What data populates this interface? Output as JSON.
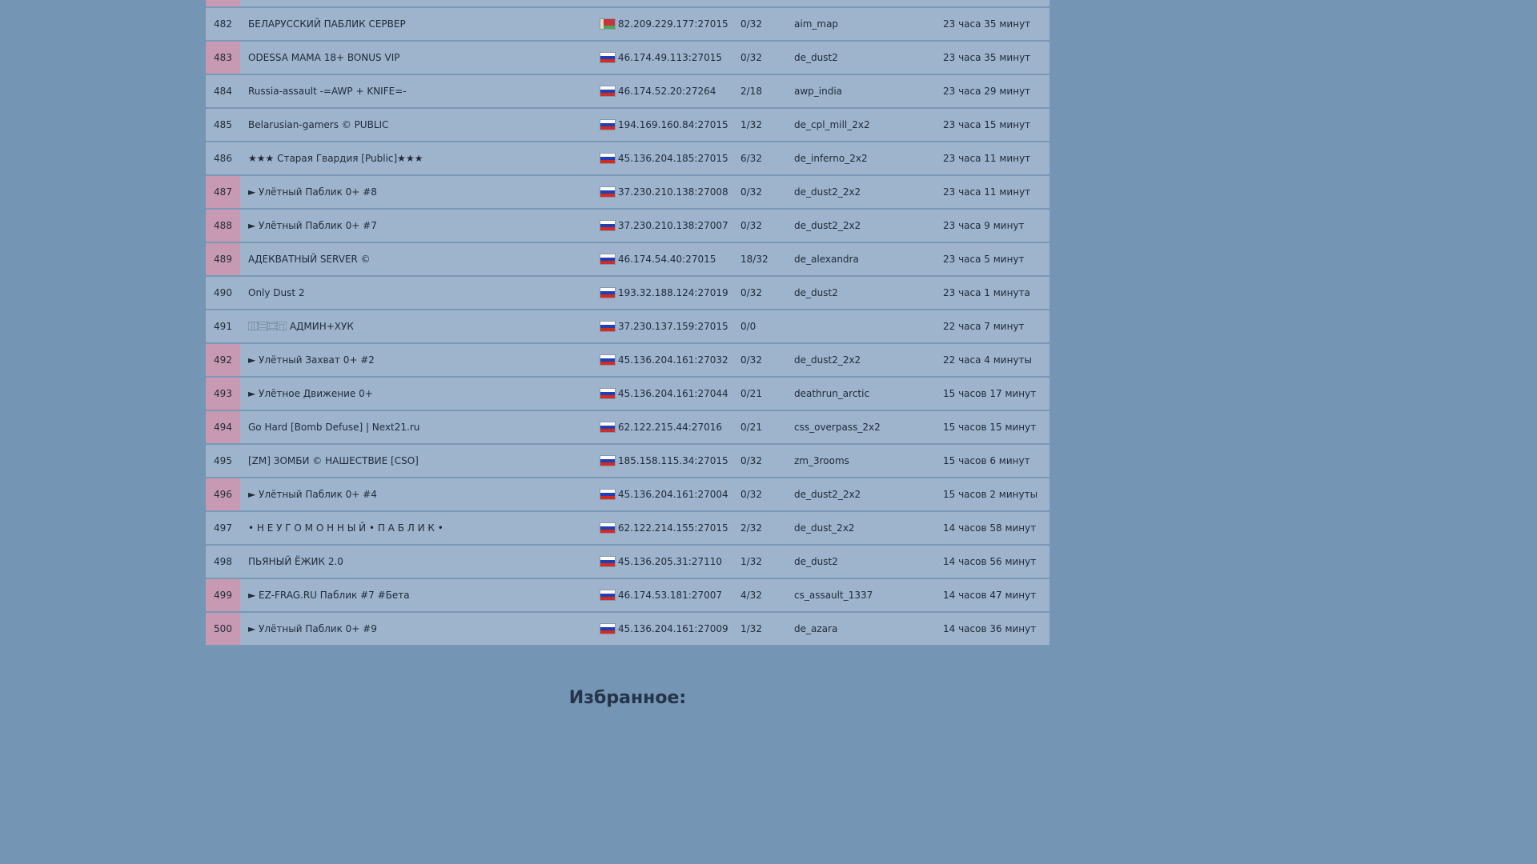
{
  "rows": [
    {
      "num": "482",
      "vip": false,
      "name": "БЕЛАРУССКИЙ ПАБЛИК СЕРВЕР",
      "flag": "by",
      "ip": "82.209.229.177:27015",
      "players": "0/32",
      "map": "aim_map",
      "time": "23 часа 35 минут"
    },
    {
      "num": "483",
      "vip": true,
      "name": "ODESSA MAMA 18+ BONUS VIP",
      "flag": "ru",
      "ip": "46.174.49.113:27015",
      "players": "0/32",
      "map": "de_dust2",
      "time": "23 часа 35 минут"
    },
    {
      "num": "484",
      "vip": false,
      "name": "Russia-assault -=AWP + KNIFE=-",
      "flag": "ru",
      "ip": "46.174.52.20:27264",
      "players": "2/18",
      "map": "awp_india",
      "time": "23 часа 29 минут"
    },
    {
      "num": "485",
      "vip": false,
      "name": "Belarusian-gamers © PUBLIC",
      "flag": "ru",
      "ip": "194.169.160.84:27015",
      "players": "1/32",
      "map": "de_cpl_mill_2x2",
      "time": "23 часа 15 минут"
    },
    {
      "num": "486",
      "vip": false,
      "name": "★★★ Старая Гвардия [Public]★★★",
      "flag": "ru",
      "ip": "45.136.204.185:27015",
      "players": "6/32",
      "map": "de_inferno_2x2",
      "time": "23 часа 11 минут"
    },
    {
      "num": "487",
      "vip": true,
      "name": "► Улётный Паблик 0+ #8",
      "flag": "ru",
      "ip": "37.230.210.138:27008",
      "players": "0/32",
      "map": "de_dust2_2x2",
      "time": "23 часа 11 минут"
    },
    {
      "num": "488",
      "vip": true,
      "name": "► Улётный Паблик 0+ #7",
      "flag": "ru",
      "ip": "37.230.210.138:27007",
      "players": "0/32",
      "map": "de_dust2_2x2",
      "time": "23 часа 9 минут"
    },
    {
      "num": "489",
      "vip": true,
      "name": "АДЕКВАТНЫЙ SERVER ©",
      "flag": "ru",
      "ip": "46.174.54.40:27015",
      "players": "18/32",
      "map": "de_alexandra",
      "time": "23 часа 5 минут"
    },
    {
      "num": "490",
      "vip": false,
      "name": "Only Dust 2",
      "flag": "ru",
      "ip": "193.32.188.124:27019",
      "players": "0/32",
      "map": "de_dust2",
      "time": "23 часа 1 минута"
    },
    {
      "num": "491",
      "vip": false,
      "name": "⿲⿳⿴⿵ АДМИН+ХУК",
      "flag": "ru",
      "ip": "37.230.137.159:27015",
      "players": "0/0",
      "map": "",
      "time": "22 часа 7 минут"
    },
    {
      "num": "492",
      "vip": true,
      "name": "► Улётный Захват 0+ #2",
      "flag": "ru",
      "ip": "45.136.204.161:27032",
      "players": "0/32",
      "map": "de_dust2_2x2",
      "time": "22 часа 4 минуты"
    },
    {
      "num": "493",
      "vip": true,
      "name": "► Улётное Движение 0+",
      "flag": "ru",
      "ip": "45.136.204.161:27044",
      "players": "0/21",
      "map": "deathrun_arctic",
      "time": "15 часов 17 минут"
    },
    {
      "num": "494",
      "vip": true,
      "name": "Go Hard [Bomb Defuse] | Next21.ru",
      "flag": "ru",
      "ip": "62.122.215.44:27016",
      "players": "0/21",
      "map": "css_overpass_2x2",
      "time": "15 часов 15 минут"
    },
    {
      "num": "495",
      "vip": false,
      "name": "[ZM] ЗОМБИ © НАШЕСТВИЕ [CSO]",
      "flag": "ru",
      "ip": "185.158.115.34:27015",
      "players": "0/32",
      "map": "zm_3rooms",
      "time": "15 часов 6 минут"
    },
    {
      "num": "496",
      "vip": true,
      "name": "► Улётный Паблик 0+ #4",
      "flag": "ru",
      "ip": "45.136.204.161:27004",
      "players": "0/32",
      "map": "de_dust2_2x2",
      "time": "15 часов 2 минуты"
    },
    {
      "num": "497",
      "vip": false,
      "name": "• Н Е У Г О М О Н Н Ы Й • П А Б Л И К •",
      "flag": "ru",
      "ip": "62.122.214.155:27015",
      "players": "2/32",
      "map": "de_dust_2x2",
      "time": "14 часов 58 минут"
    },
    {
      "num": "498",
      "vip": false,
      "name": "ПЬЯНЫЙ ЁЖИК 2.0",
      "flag": "ru",
      "ip": "45.136.205.31:27110",
      "players": "1/32",
      "map": "de_dust2",
      "time": "14 часов 56 минут"
    },
    {
      "num": "499",
      "vip": true,
      "name": "► EZ-FRAG.RU Паблик #7 #Бета",
      "flag": "ru",
      "ip": "46.174.53.181:27007",
      "players": "4/32",
      "map": "cs_assault_1337",
      "time": "14 часов 47 минут"
    },
    {
      "num": "500",
      "vip": true,
      "name": "► Улётный Паблик 0+ #9",
      "flag": "ru",
      "ip": "45.136.204.161:27009",
      "players": "1/32",
      "map": "de_azara",
      "time": "14 часов 36 минут"
    }
  ],
  "favorites_title": "Избранное:",
  "colors": {
    "background": "#7595b4",
    "row": "#9db4cc",
    "vip_cell": "#c79ab1"
  }
}
